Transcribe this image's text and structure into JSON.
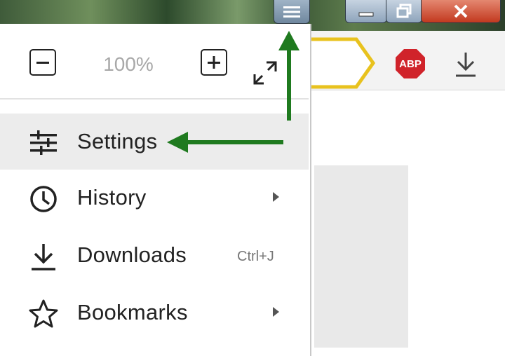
{
  "window": {
    "menu_icon": "hamburger-icon",
    "minimize_icon": "minimize-icon",
    "maximize_icon": "restore-icon",
    "close_icon": "close-icon",
    "close_color": "#c94a2e"
  },
  "toolbar": {
    "adblock_label": "ABP",
    "adblock_color": "#d0232a",
    "download_icon": "download-icon"
  },
  "zoom": {
    "zoom_out_icon": "minus-icon",
    "value": "100%",
    "zoom_in_icon": "plus-icon",
    "fullscreen_icon": "fullscreen-icon"
  },
  "menu": {
    "items": [
      {
        "label": "Settings",
        "icon": "settings-sliders-icon",
        "highlighted": true
      },
      {
        "label": "History",
        "icon": "clock-icon",
        "submenu": true
      },
      {
        "label": "Downloads",
        "icon": "download-icon",
        "shortcut": "Ctrl+J"
      },
      {
        "label": "Bookmarks",
        "icon": "star-icon",
        "submenu": true
      }
    ]
  },
  "annotations": {
    "arrow_color": "#1f7a1f"
  }
}
